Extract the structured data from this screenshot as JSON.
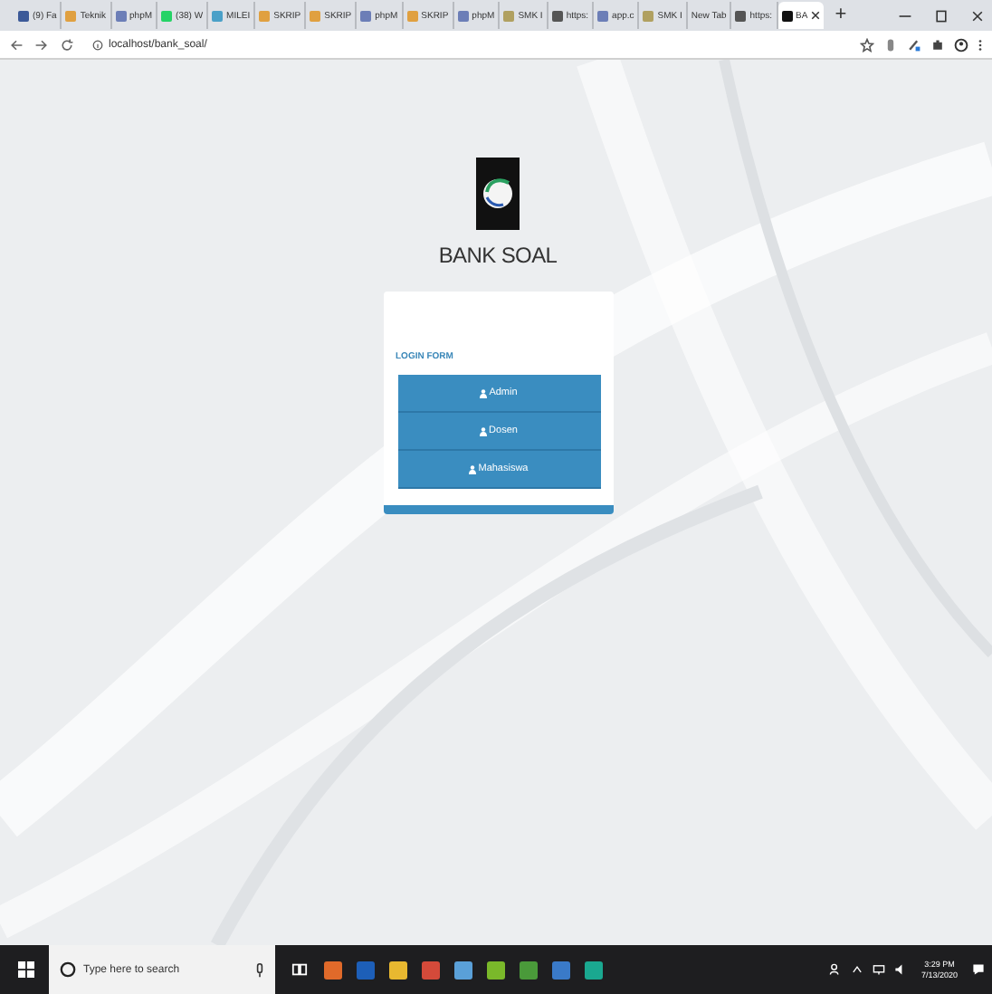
{
  "browser": {
    "tabs": [
      {
        "title": "(9) Fa",
        "kind": "facebook",
        "selected": false
      },
      {
        "title": "Teknik",
        "kind": "feather",
        "selected": false
      },
      {
        "title": "phpM",
        "kind": "php",
        "selected": false
      },
      {
        "title": "(38) W",
        "kind": "whatsapp",
        "selected": false
      },
      {
        "title": "MILEI",
        "kind": "people",
        "selected": false
      },
      {
        "title": "SKRIP",
        "kind": "feather",
        "selected": false
      },
      {
        "title": "SKRIP",
        "kind": "feather",
        "selected": false
      },
      {
        "title": "phpM",
        "kind": "php",
        "selected": false
      },
      {
        "title": "SKRIP",
        "kind": "feather",
        "selected": false
      },
      {
        "title": "phpM",
        "kind": "php",
        "selected": false
      },
      {
        "title": "SMK I",
        "kind": "doc",
        "selected": false
      },
      {
        "title": "https:",
        "kind": "globe",
        "selected": false
      },
      {
        "title": "app.c",
        "kind": "php",
        "selected": false
      },
      {
        "title": "SMK I",
        "kind": "doc",
        "selected": false
      },
      {
        "title": "New Tab",
        "kind": "blank",
        "selected": false
      },
      {
        "title": "https:",
        "kind": "globe",
        "selected": false
      },
      {
        "title": "BA",
        "kind": "logo",
        "selected": true
      }
    ],
    "new_tab": "+",
    "url": "localhost/bank_soal/"
  },
  "page": {
    "title": "BANK SOAL",
    "form_title": "LOGIN FORM",
    "buttons": [
      "Admin",
      "Dosen",
      "Mahasiswa"
    ]
  },
  "taskbar": {
    "search_placeholder": "Type here to search",
    "time": "3:29 PM",
    "date": "7/13/2020"
  }
}
